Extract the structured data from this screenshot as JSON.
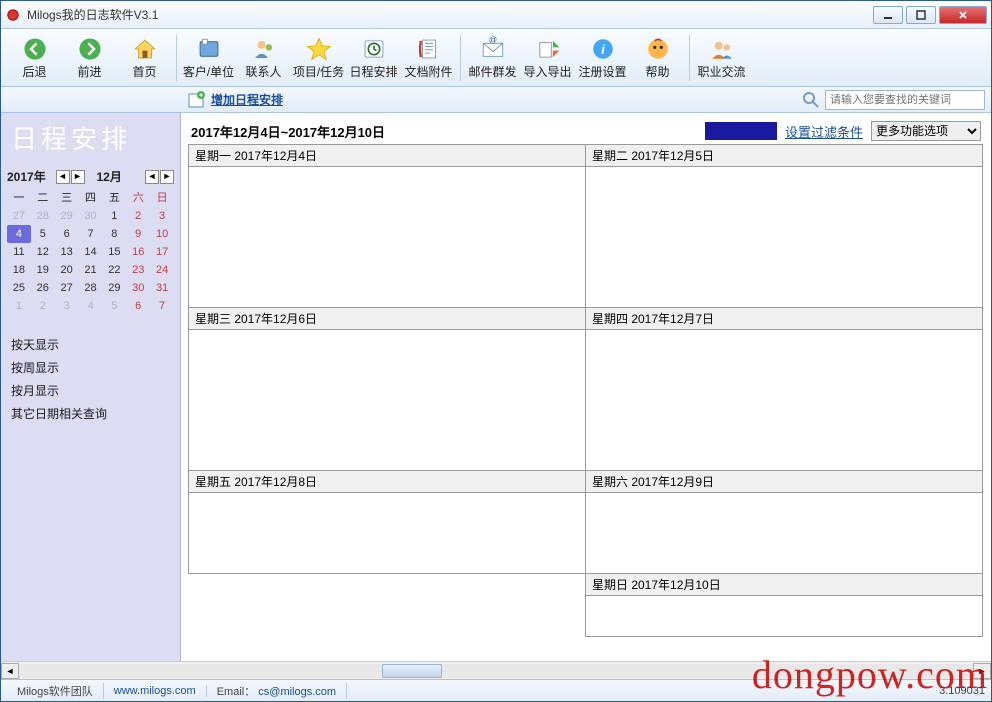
{
  "window": {
    "title": "Milogs我的日志软件V3.1"
  },
  "toolbar": {
    "back": "后退",
    "forward": "前进",
    "home": "首页",
    "clients": "客户/单位",
    "contacts": "联系人",
    "projects": "项目/任务",
    "schedule": "日程安排",
    "attachments": "文档附件",
    "mail": "邮件群发",
    "import": "导入导出",
    "register": "注册设置",
    "help": "帮助",
    "career": "职业交流"
  },
  "actionbar": {
    "add": "增加日程安排",
    "search_placeholder": "请输入您要查找的关键词"
  },
  "sidebar": {
    "title": "日程安排",
    "year": "2017年",
    "month": "12月",
    "dow": [
      "一",
      "二",
      "三",
      "四",
      "五",
      "六",
      "日"
    ],
    "weeks": [
      [
        "27",
        "28",
        "29",
        "30",
        "1",
        "2",
        "3"
      ],
      [
        "4",
        "5",
        "6",
        "7",
        "8",
        "9",
        "10"
      ],
      [
        "11",
        "12",
        "13",
        "14",
        "15",
        "16",
        "17"
      ],
      [
        "18",
        "19",
        "20",
        "21",
        "22",
        "23",
        "24"
      ],
      [
        "25",
        "26",
        "27",
        "28",
        "29",
        "30",
        "31"
      ],
      [
        "1",
        "2",
        "3",
        "4",
        "5",
        "6",
        "7"
      ]
    ],
    "links": {
      "day": "按天显示",
      "week": "按周显示",
      "month": "按月显示",
      "other": "其它日期相关查询"
    }
  },
  "content": {
    "range": "2017年12月4日~2017年12月10日",
    "filter": "设置过滤条件",
    "more": "更多功能选项",
    "days": {
      "mon": "星期一  2017年12月4日",
      "tue": "星期二  2017年12月5日",
      "wed": "星期三  2017年12月6日",
      "thu": "星期四  2017年12月7日",
      "fri": "星期五  2017年12月8日",
      "sat": "星期六  2017年12月9日",
      "sun": "星期日  2017年12月10日"
    }
  },
  "status": {
    "team": "Milogs软件团队",
    "site": "www.milogs.com",
    "email_label": "Email：",
    "email": "cs@milogs.com",
    "version": "3.109031"
  },
  "watermark": "dongpow.com"
}
